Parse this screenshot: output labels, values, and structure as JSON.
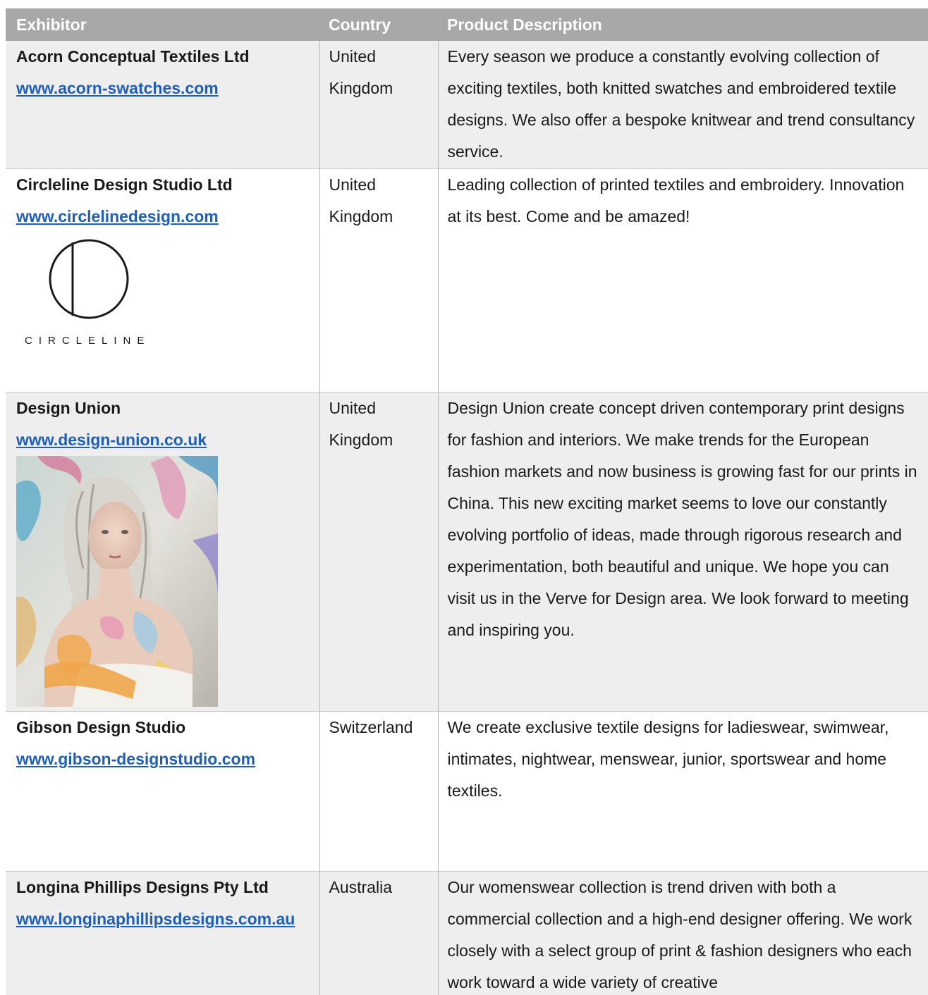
{
  "table": {
    "headers": [
      "Exhibitor",
      "Country",
      "Product Description"
    ],
    "rows": [
      {
        "name": "Acorn Conceptual Textiles Ltd",
        "url": "www.acorn-swatches.com",
        "country": "United Kingdom",
        "description": "Every season we produce a constantly evolving collection of exciting textiles, both knitted swatches and embroidered textile designs. We also offer a bespoke knitwear and trend consultancy service."
      },
      {
        "name": "Circleline Design Studio Ltd",
        "url": "www.circlelinedesign.com",
        "country": "United Kingdom",
        "description": "Leading collection of printed textiles and embroidery. Innovation at its best. Come and be amazed!",
        "logo_text": "CIRCLELINE"
      },
      {
        "name": "Design Union",
        "url": "www.design-union.co.uk",
        "country": "United Kingdom",
        "description": "Design Union create concept driven contemporary print designs for fashion and interiors. We make trends for the European fashion markets and now business is growing fast for our prints in China. This new exciting market seems to love our constantly evolving portfolio of ideas, made through rigorous research and experimentation, both beautiful and unique. We hope you can visit us in the Verve for Design area. We look forward to meeting and inspiring you."
      },
      {
        "name": "Gibson Design Studio",
        "url": "www.gibson-designstudio.com",
        "country": "Switzerland",
        "description": "We create exclusive textile designs for ladieswear, swimwear, intimates, nightwear, menswear, junior, sportswear and home textiles."
      },
      {
        "name": "Longina Phillips Designs Pty Ltd",
        "url": "www.longinaphillipsdesigns.com.au",
        "country": "Australia",
        "description": "Our womenswear collection is trend driven with both a commercial collection and a high-end designer offering. We work closely with a select group of print & fashion designers who each work toward a wide variety of creative"
      }
    ]
  },
  "colors": {
    "header_bg": "#a8a8a8",
    "shaded_row_bg": "#eeeeee",
    "link": "#1f5fb8"
  }
}
